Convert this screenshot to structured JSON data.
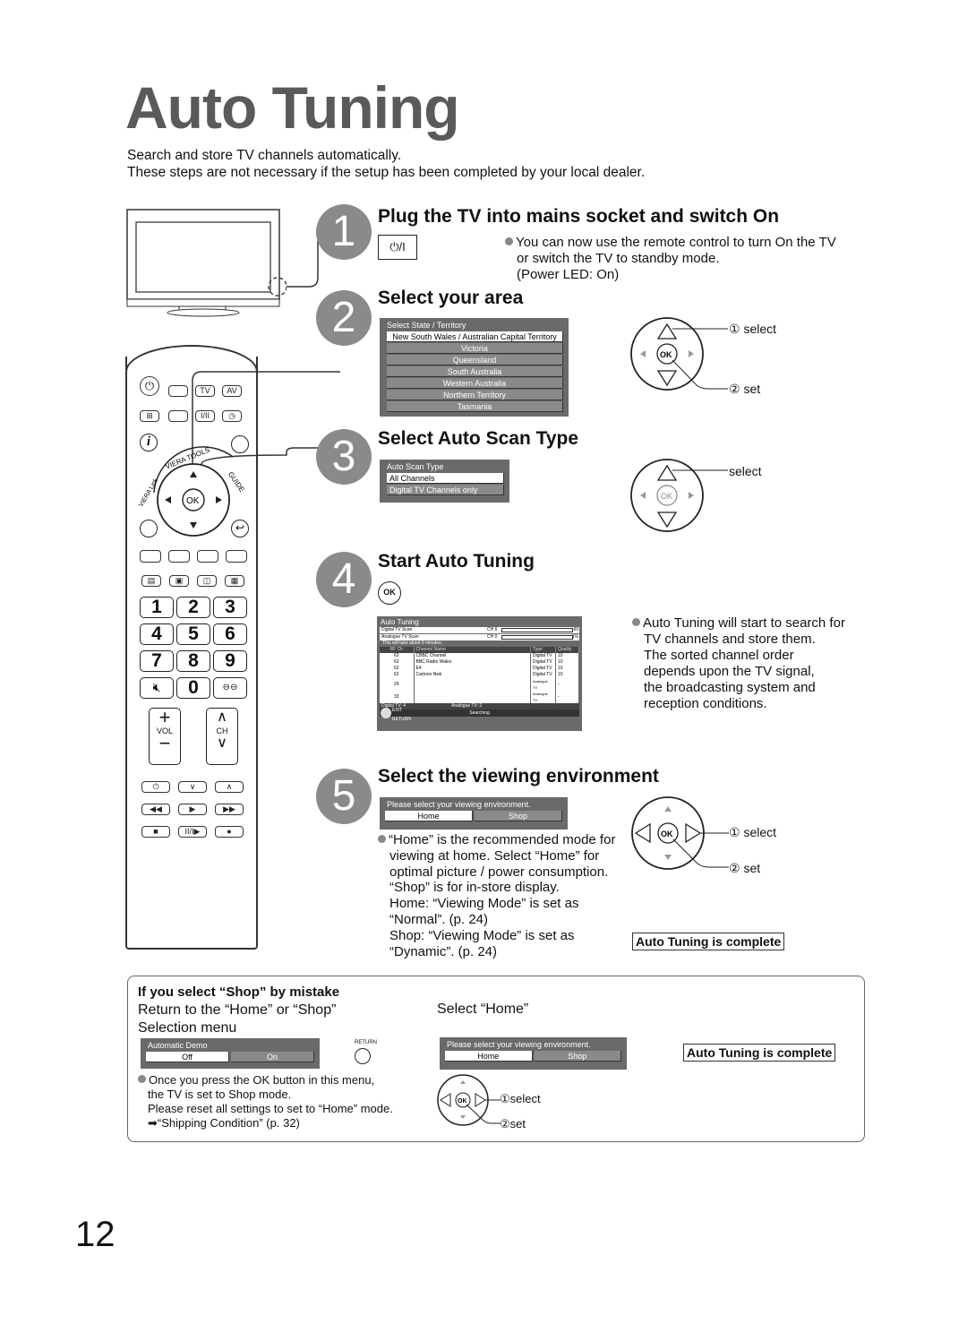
{
  "page": {
    "title": "Auto Tuning",
    "intro": [
      "Search and store TV channels automatically.",
      "These steps are not necessary if the setup has been completed by your local dealer."
    ],
    "page_number": "12"
  },
  "steps": [
    {
      "number": "1",
      "title": "Plug the TV into mains socket and switch On",
      "button_label": "⏻/I",
      "bullet": [
        "You can now use the remote control to turn On the TV",
        "or switch the TV to standby mode.",
        "(Power LED: On)"
      ]
    },
    {
      "number": "2",
      "title": "Select your area",
      "osd": {
        "header": "Select State / Territory",
        "options": [
          "New South Wales / Australian Capital Territory",
          "Victoria",
          "Queensland",
          "South Australia",
          "Western Australia",
          "Northern Territory",
          "Tasmania"
        ],
        "selected": 0
      },
      "nav": {
        "ok": "OK",
        "select": "① select",
        "set": "② set"
      }
    },
    {
      "number": "3",
      "title": "Select Auto Scan Type",
      "osd": {
        "header": "Auto Scan Type",
        "options": [
          "All Channels",
          "Digital TV Channels only"
        ],
        "selected": 0
      },
      "nav": {
        "ok": "OK",
        "select": "select"
      }
    },
    {
      "number": "4",
      "title": "Start Auto Tuning",
      "ok_label": "OK",
      "osd": {
        "header": "Auto Tuning",
        "scans": [
          {
            "label": "Digital TV Scan",
            "ch": "CH 6",
            "progress_pct": 69,
            "pct_label": "69"
          },
          {
            "label": "Analogue TV Scan",
            "ch": "CH 0",
            "progress_pct": 1,
            "pct_label": "1%"
          }
        ],
        "note": "This will take about 6 minutes.",
        "columns": [
          "RF Ch",
          "Channel Name",
          "Type",
          "Quality"
        ],
        "rows": [
          [
            "62",
            "CBBC Channel",
            "Digital TV",
            "10"
          ],
          [
            "62",
            "BBC Radio Wales",
            "Digital TV",
            "10"
          ],
          [
            "62",
            "E4",
            "Digital TV",
            "10"
          ],
          [
            "62",
            "Cartoon Nwk",
            "Digital TV",
            "10"
          ],
          [
            "29",
            "",
            "Analogue TV",
            "-"
          ],
          [
            "33",
            "",
            "Analogue TV",
            "-"
          ]
        ],
        "digital_count": "Digital TV: 4",
        "analogue_count": "Analogue TV: 2",
        "status": "Searching",
        "exit": "EXIT",
        "return": "RETURN"
      },
      "bullet": [
        "Auto Tuning will start to search for",
        "TV channels and store them.",
        "The sorted channel order",
        "depends upon the TV signal,",
        "the broadcasting system and",
        "reception conditions."
      ]
    },
    {
      "number": "5",
      "title": "Select the viewing environment",
      "osd": {
        "header": "Please select your viewing environment.",
        "options": [
          "Home",
          "Shop"
        ],
        "selected": 0
      },
      "bullet": [
        "“Home” is the recommended mode for",
        "viewing at home. Select “Home” for",
        "optimal picture / power consumption.",
        "“Shop” is for in-store display.",
        "Home: “Viewing Mode” is set as",
        "“Normal”. (p. 24)",
        "Shop: “Viewing Mode” is set as",
        "“Dynamic”. (p. 24)"
      ],
      "nav": {
        "ok": "OK",
        "select": "① select",
        "set": "② set"
      },
      "complete": "Auto Tuning is complete"
    }
  ],
  "mistake": {
    "title": "If you select “Shop” by mistake",
    "left_heading": [
      "Return to the “Home” or “Shop”",
      "Selection menu"
    ],
    "demo_osd": {
      "header": "Automatic Demo",
      "options": [
        "Off",
        "On"
      ],
      "selected": 0
    },
    "return_label": "RETURN",
    "bullet": [
      "Once you press the OK button in this menu,",
      "the TV is set to Shop mode.",
      "Please reset all settings to set to “Home” mode."
    ],
    "ref": "“Shipping Condition” (p. 32)",
    "right_heading": "Select “Home”",
    "env_osd": {
      "header": "Please select your viewing environment.",
      "options": [
        "Home",
        "Shop"
      ],
      "selected": 0
    },
    "nav": {
      "ok": "OK",
      "select": "①select",
      "set": "②set"
    },
    "complete": "Auto Tuning is complete"
  },
  "remote": {
    "tv": "TV",
    "av": "AV",
    "ok": "OK",
    "vol": "VOL",
    "ch": "CH",
    "viera_tools": "VIERA TOOLS",
    "viera_link": "VIERA Link",
    "guide": "GUIDE",
    "numbers": [
      "1",
      "2",
      "3",
      "4",
      "5",
      "6",
      "7",
      "8",
      "9",
      "0"
    ]
  }
}
